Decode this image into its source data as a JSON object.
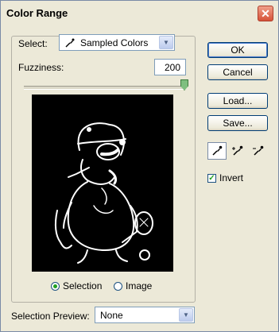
{
  "window": {
    "title": "Color Range",
    "close_glyph": "✕"
  },
  "select": {
    "label": "Select:",
    "value": "Sampled Colors"
  },
  "fuzziness": {
    "label": "Fuzziness:",
    "value": "200",
    "level_fraction": 1.0
  },
  "view_mode": {
    "selection_label": "Selection",
    "image_label": "Image",
    "selected": "selection"
  },
  "selection_preview": {
    "label": "Selection Preview:",
    "value": "None"
  },
  "buttons": {
    "ok": "OK",
    "cancel": "Cancel",
    "load": "Load...",
    "save": "Save..."
  },
  "eyedroppers": [
    {
      "icon": "eyedropper-icon",
      "selected": true
    },
    {
      "icon": "eyedropper-plus-icon",
      "selected": false
    },
    {
      "icon": "eyedropper-minus-icon",
      "selected": false
    }
  ],
  "invert": {
    "label": "Invert",
    "checked": true
  }
}
